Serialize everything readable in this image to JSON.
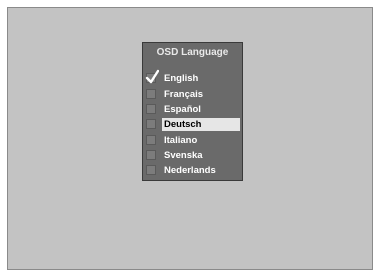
{
  "menu": {
    "title": "OSD Language",
    "items": [
      {
        "label": "English",
        "checked": true,
        "selected": false
      },
      {
        "label": "Français",
        "checked": false,
        "selected": false
      },
      {
        "label": "Español",
        "checked": false,
        "selected": false
      },
      {
        "label": "Deutsch",
        "checked": false,
        "selected": true
      },
      {
        "label": "Italiano",
        "checked": false,
        "selected": false
      },
      {
        "label": "Svenska",
        "checked": false,
        "selected": false
      },
      {
        "label": "Nederlands",
        "checked": false,
        "selected": false
      }
    ]
  },
  "icons": {
    "check": "checkmark-icon",
    "box": "checkbox-icon"
  },
  "colors": {
    "screen_bg": "#c3c3c3",
    "menu_bg": "#6a6a6a",
    "highlight_bg": "#e6e6e6",
    "text": "#ffffff"
  }
}
